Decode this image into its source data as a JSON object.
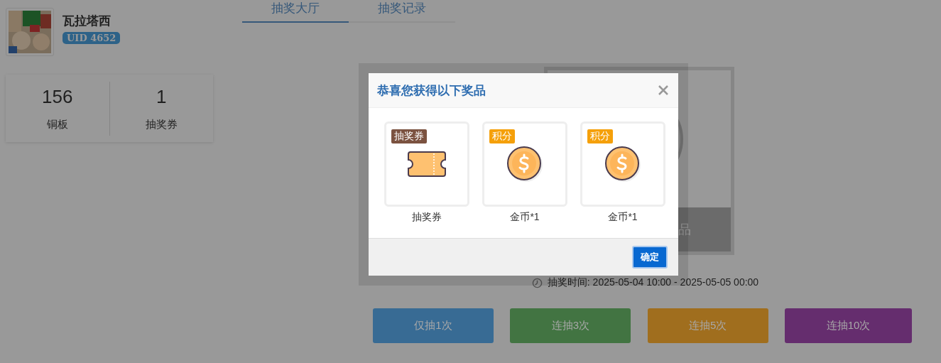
{
  "user": {
    "name": "瓦拉塔西",
    "uid": "UID 4652"
  },
  "stats": [
    {
      "value": "156",
      "label": "铜板"
    },
    {
      "value": "1",
      "label": "抽奖券"
    }
  ],
  "tabs": [
    {
      "label": "抽奖大厅",
      "selected": true
    },
    {
      "label": "抽奖记录",
      "selected": false
    }
  ],
  "prize_card": {
    "caption": "品"
  },
  "draw_time": "抽奖时间: 2025-05-04 10:00 - 2025-05-05 00:00",
  "draw_buttons": [
    {
      "label": "仅抽1次",
      "color": "#386b94"
    },
    {
      "label": "连抽3次",
      "color": "#427442"
    },
    {
      "label": "连抽5次",
      "color": "#a06e1e"
    },
    {
      "label": "连抽10次",
      "color": "#652d6e"
    }
  ],
  "dialog": {
    "title": "恭喜您获得以下奖品",
    "confirm": "确定",
    "prizes": [
      {
        "kind": "ticket",
        "tag": "抽奖券",
        "label": "抽奖券"
      },
      {
        "kind": "coin",
        "tag": "积分",
        "label": "金币*1"
      },
      {
        "kind": "coin",
        "tag": "积分",
        "label": "金币*1"
      }
    ]
  }
}
